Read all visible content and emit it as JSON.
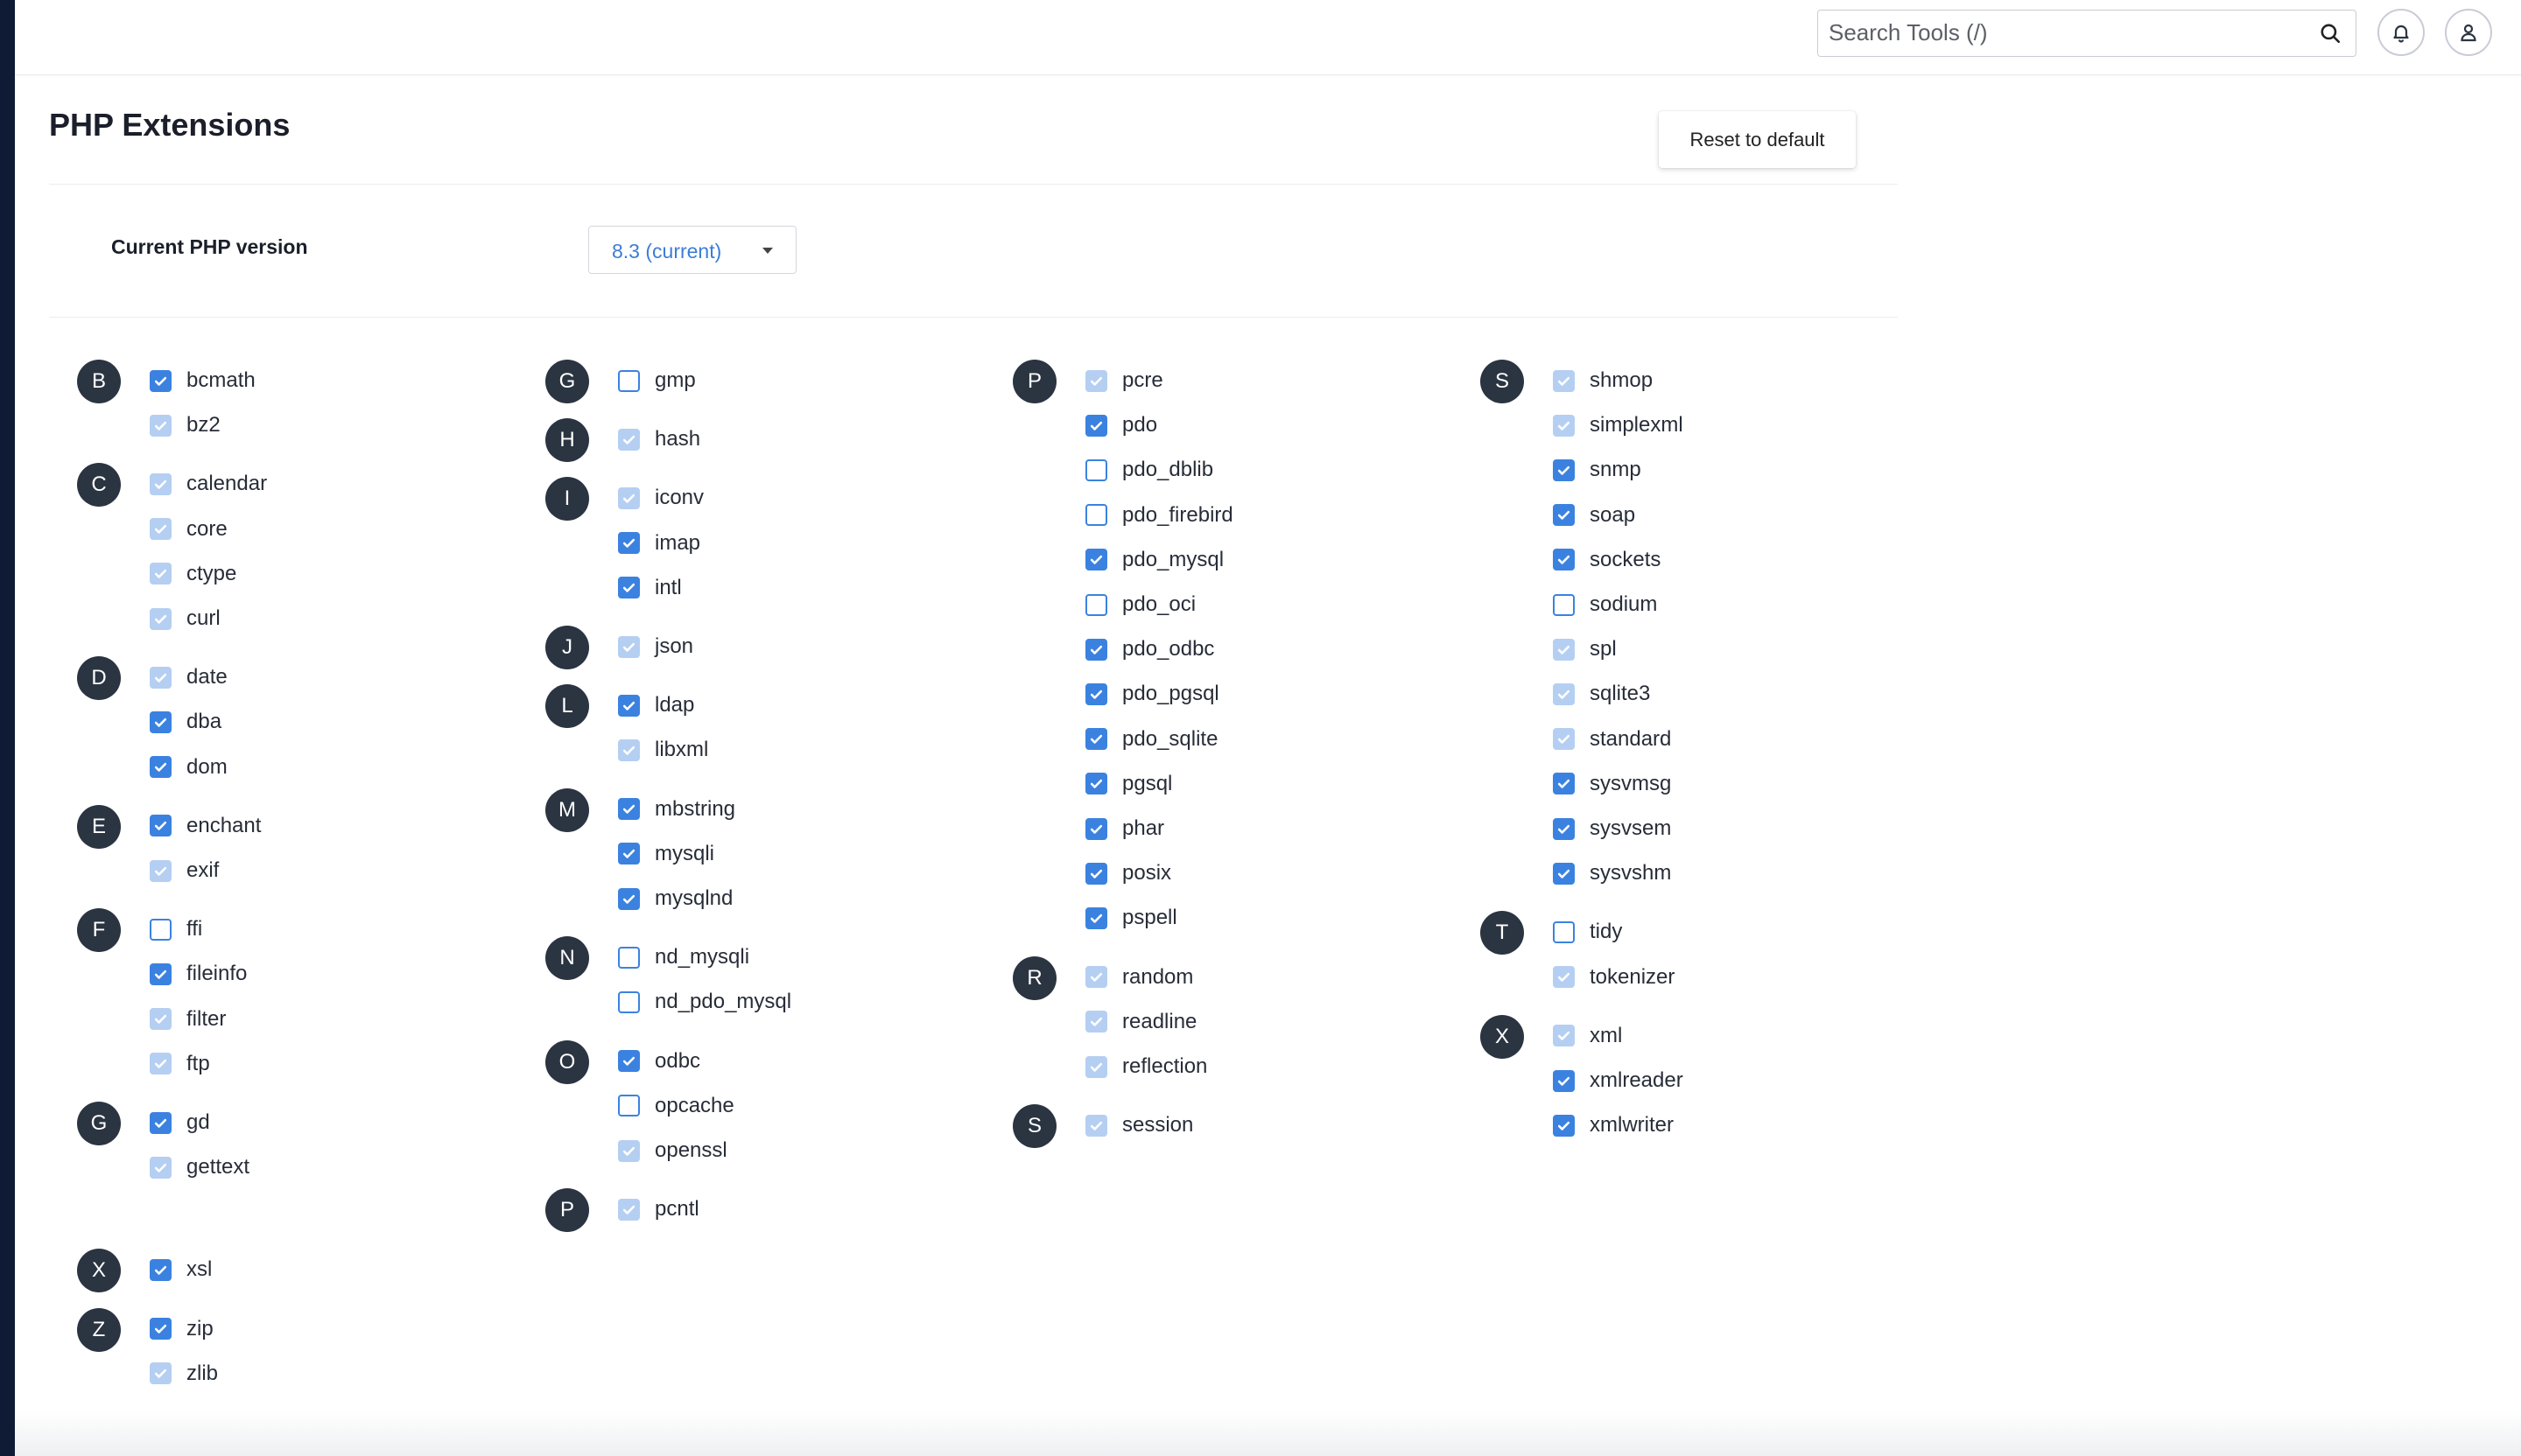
{
  "header": {
    "search_placeholder": "Search Tools (/)"
  },
  "page": {
    "title": "PHP Extensions",
    "reset_label": "Reset to default",
    "version_label": "Current PHP version",
    "version_value": "8.3 (current)"
  },
  "colors": {
    "rail": "#0f1b35",
    "checkbox_checked": "#3b82e0",
    "checkbox_disabled": "#b5cff2",
    "letter_badge": "#2b3441"
  },
  "columns": [
    {
      "groups": [
        {
          "letter": "B",
          "items": [
            {
              "name": "bcmath",
              "state": "on"
            },
            {
              "name": "bz2",
              "state": "dis"
            }
          ]
        },
        {
          "letter": "C",
          "items": [
            {
              "name": "calendar",
              "state": "dis"
            },
            {
              "name": "core",
              "state": "dis"
            },
            {
              "name": "ctype",
              "state": "dis"
            },
            {
              "name": "curl",
              "state": "dis"
            }
          ]
        },
        {
          "letter": "D",
          "items": [
            {
              "name": "date",
              "state": "dis"
            },
            {
              "name": "dba",
              "state": "on"
            },
            {
              "name": "dom",
              "state": "on"
            }
          ]
        },
        {
          "letter": "E",
          "items": [
            {
              "name": "enchant",
              "state": "on"
            },
            {
              "name": "exif",
              "state": "dis"
            }
          ]
        },
        {
          "letter": "F",
          "items": [
            {
              "name": "ffi",
              "state": "off"
            },
            {
              "name": "fileinfo",
              "state": "on"
            },
            {
              "name": "filter",
              "state": "dis"
            },
            {
              "name": "ftp",
              "state": "dis"
            }
          ]
        },
        {
          "letter": "G",
          "items": [
            {
              "name": "gd",
              "state": "on"
            },
            {
              "name": "gettext",
              "state": "dis"
            }
          ]
        },
        {
          "letter": "X",
          "items": [
            {
              "name": "xsl",
              "state": "on"
            }
          ]
        },
        {
          "letter": "Z",
          "items": [
            {
              "name": "zip",
              "state": "on"
            },
            {
              "name": "zlib",
              "state": "dis"
            }
          ]
        }
      ]
    },
    {
      "groups": [
        {
          "letter": "G",
          "items": [
            {
              "name": "gmp",
              "state": "off"
            }
          ]
        },
        {
          "letter": "H",
          "items": [
            {
              "name": "hash",
              "state": "dis"
            }
          ]
        },
        {
          "letter": "I",
          "items": [
            {
              "name": "iconv",
              "state": "dis"
            },
            {
              "name": "imap",
              "state": "on"
            },
            {
              "name": "intl",
              "state": "on"
            }
          ]
        },
        {
          "letter": "J",
          "items": [
            {
              "name": "json",
              "state": "dis"
            }
          ]
        },
        {
          "letter": "L",
          "items": [
            {
              "name": "ldap",
              "state": "on"
            },
            {
              "name": "libxml",
              "state": "dis"
            }
          ]
        },
        {
          "letter": "M",
          "items": [
            {
              "name": "mbstring",
              "state": "on"
            },
            {
              "name": "mysqli",
              "state": "on"
            },
            {
              "name": "mysqlnd",
              "state": "on"
            }
          ]
        },
        {
          "letter": "N",
          "items": [
            {
              "name": "nd_mysqli",
              "state": "off"
            },
            {
              "name": "nd_pdo_mysql",
              "state": "off"
            }
          ]
        },
        {
          "letter": "O",
          "items": [
            {
              "name": "odbc",
              "state": "on"
            },
            {
              "name": "opcache",
              "state": "off"
            },
            {
              "name": "openssl",
              "state": "dis"
            }
          ]
        },
        {
          "letter": "P",
          "items": [
            {
              "name": "pcntl",
              "state": "dis"
            }
          ]
        }
      ]
    },
    {
      "groups": [
        {
          "letter": "P",
          "items": [
            {
              "name": "pcre",
              "state": "dis"
            },
            {
              "name": "pdo",
              "state": "on"
            },
            {
              "name": "pdo_dblib",
              "state": "off"
            },
            {
              "name": "pdo_firebird",
              "state": "off"
            },
            {
              "name": "pdo_mysql",
              "state": "on"
            },
            {
              "name": "pdo_oci",
              "state": "off"
            },
            {
              "name": "pdo_odbc",
              "state": "on"
            },
            {
              "name": "pdo_pgsql",
              "state": "on"
            },
            {
              "name": "pdo_sqlite",
              "state": "on"
            },
            {
              "name": "pgsql",
              "state": "on"
            },
            {
              "name": "phar",
              "state": "on"
            },
            {
              "name": "posix",
              "state": "on"
            },
            {
              "name": "pspell",
              "state": "on"
            }
          ]
        },
        {
          "letter": "R",
          "items": [
            {
              "name": "random",
              "state": "dis"
            },
            {
              "name": "readline",
              "state": "dis"
            },
            {
              "name": "reflection",
              "state": "dis"
            }
          ]
        },
        {
          "letter": "S",
          "items": [
            {
              "name": "session",
              "state": "dis"
            }
          ]
        }
      ]
    },
    {
      "groups": [
        {
          "letter": "S",
          "items": [
            {
              "name": "shmop",
              "state": "dis"
            },
            {
              "name": "simplexml",
              "state": "dis"
            },
            {
              "name": "snmp",
              "state": "on"
            },
            {
              "name": "soap",
              "state": "on"
            },
            {
              "name": "sockets",
              "state": "on"
            },
            {
              "name": "sodium",
              "state": "off"
            },
            {
              "name": "spl",
              "state": "dis"
            },
            {
              "name": "sqlite3",
              "state": "dis"
            },
            {
              "name": "standard",
              "state": "dis"
            },
            {
              "name": "sysvmsg",
              "state": "on"
            },
            {
              "name": "sysvsem",
              "state": "on"
            },
            {
              "name": "sysvshm",
              "state": "on"
            }
          ]
        },
        {
          "letter": "T",
          "items": [
            {
              "name": "tidy",
              "state": "off"
            },
            {
              "name": "tokenizer",
              "state": "dis"
            }
          ]
        },
        {
          "letter": "X",
          "items": [
            {
              "name": "xml",
              "state": "dis"
            },
            {
              "name": "xmlreader",
              "state": "on"
            },
            {
              "name": "xmlwriter",
              "state": "on"
            }
          ]
        }
      ]
    }
  ]
}
